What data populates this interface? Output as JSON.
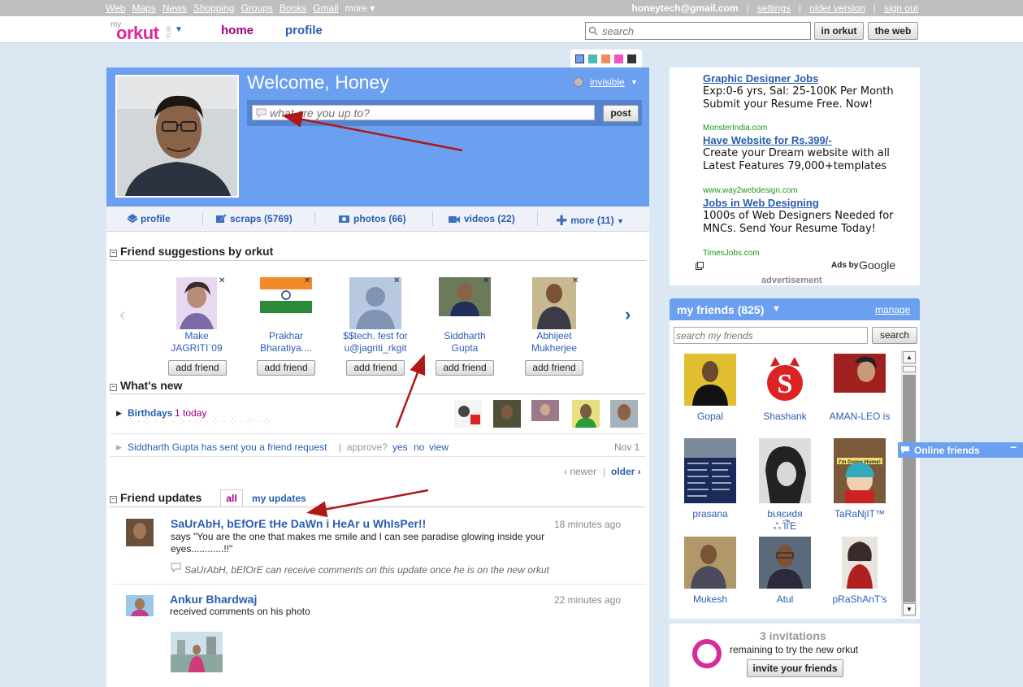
{
  "topbar": {
    "links": [
      "Web",
      "Maps",
      "News",
      "Shopping",
      "Groups",
      "Books",
      "Gmail",
      "more ▾"
    ],
    "email": "honeytech@gmail.com",
    "settings": "settings",
    "older_version": "older version",
    "sign_out": "sign out"
  },
  "header": {
    "logo_my": "my",
    "logo_text": "orkut",
    "logo_beta": "BETA",
    "nav_home": "home",
    "nav_profile": "profile",
    "search_placeholder": "search",
    "btn_in_orkut": "in orkut",
    "btn_web": "the web"
  },
  "welcome": {
    "title": "Welcome, Honey",
    "status_placeholder": "what are you up to?",
    "post": "post",
    "presence": "invisible"
  },
  "tabs": [
    {
      "label": "profile"
    },
    {
      "label": "scraps (5769)"
    },
    {
      "label": "photos (66)"
    },
    {
      "label": "videos (22)"
    },
    {
      "label": "more (11)"
    }
  ],
  "suggestions": {
    "title": "Friend suggestions by orkut",
    "add_label": "add friend",
    "items": [
      {
        "line1": "Make",
        "line2": "JAGRITI`09"
      },
      {
        "line1": "Prakhar",
        "line2": "Bharatiya...."
      },
      {
        "line1": "$$tech. fest for",
        "line2": "u@jagriti_rkgit"
      },
      {
        "line1": "Siddharth",
        "line2": "Gupta"
      },
      {
        "line1": "Abhijeet",
        "line2": "Mukherjee"
      }
    ]
  },
  "whats_new": {
    "title": "What's new",
    "birthdays": "Birthdays",
    "birthdays_count": "1 today",
    "request_text": "Siddharth Gupta has sent you a friend request",
    "approve": "approve?",
    "yes": "yes",
    "no": "no",
    "view": "view",
    "date": "Nov 1",
    "newer": "‹ newer",
    "older": "older ›"
  },
  "updates": {
    "title": "Friend updates",
    "tab_all": "all",
    "tab_mine": "my updates",
    "items": [
      {
        "name": "SaUrAbH, bEfOrE tHe DaWn i HeAr u WhIsPer!!",
        "time": "18 minutes ago",
        "text": "says \"You are the one that makes me smile and I can see paradise glowing inside your eyes............!!\"",
        "note": "SaUrAbH, bEfOrE can receive comments on this update once he is on the new orkut"
      },
      {
        "name": "Ankur Bhardwaj",
        "time": "22 minutes ago",
        "text": "received comments on his photo"
      }
    ]
  },
  "ads": {
    "items": [
      {
        "title": "Graphic Designer Jobs",
        "body": "Exp:0-6 yrs, Sal: 25-100K Per Month Submit your Resume Free. Now!",
        "url": "MonsterIndia.com"
      },
      {
        "title": "Have Website for Rs.399/-",
        "body": "Create your Dream website with all Latest Features 79,000+templates",
        "url": "www.way2webdesign.com"
      },
      {
        "title": "Jobs in Web Designing",
        "body": "1000s of Web Designers Needed for MNCs. Send Your Resume Today!",
        "url": "TimesJobs.com"
      }
    ],
    "ads_by": "Ads by",
    "google": "Google",
    "label": "advertisement"
  },
  "friends": {
    "title": "my friends (825)",
    "manage": "manage",
    "search_placeholder": "search my friends",
    "search_btn": "search",
    "items": [
      {
        "name": "Gopal"
      },
      {
        "name": "Shashank"
      },
      {
        "name": "AMAN-LEO is"
      },
      {
        "name": "prasana"
      },
      {
        "name": "bเяєиdя",
        "name2": "ஃ ̄l͡ÎΈ"
      },
      {
        "name": "TaRaNjIT™"
      },
      {
        "name": "Mukesh"
      },
      {
        "name": "Atul"
      },
      {
        "name": "pRaShAnT's"
      }
    ],
    "online": "Online friends",
    "photo_texts": {
      "shashank_s": "S",
      "cartman": "I'm Going Home!"
    }
  },
  "invitations": {
    "title": "3 invitations",
    "text": "remaining to try the new orkut",
    "btn": "invite your friends"
  },
  "colors": {
    "accent": "#6b9ff0",
    "link": "#2a5db0",
    "home": "#a3007d",
    "page_bg": "#dce7f4"
  }
}
